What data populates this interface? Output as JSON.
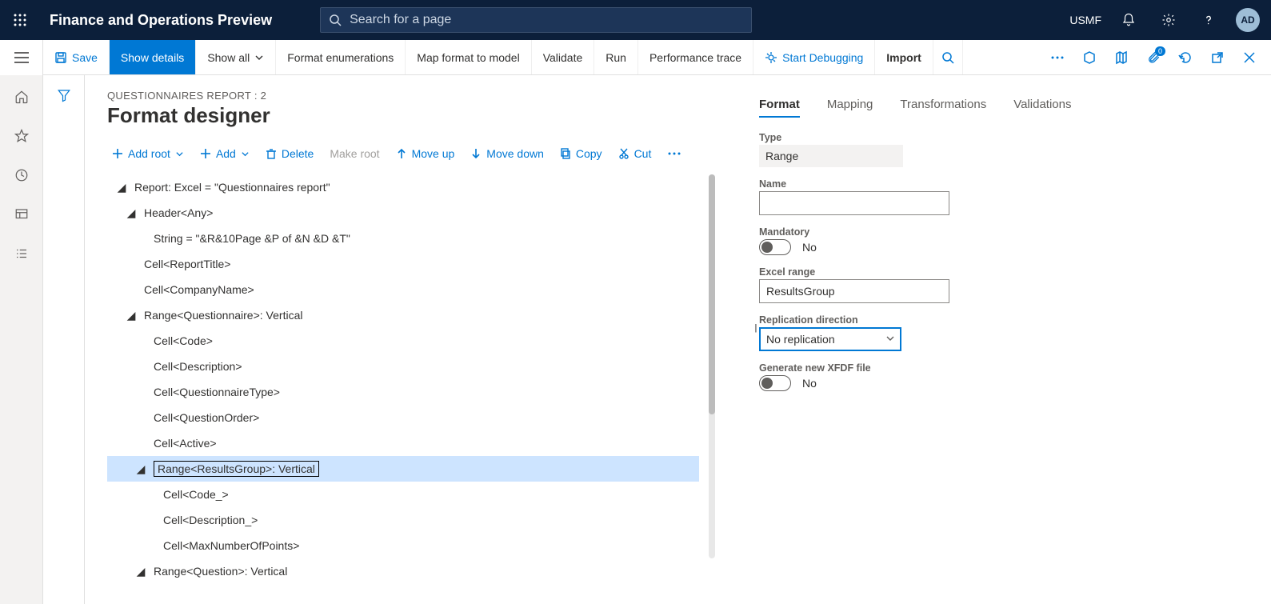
{
  "topbar": {
    "app_title": "Finance and Operations Preview",
    "search_placeholder": "Search for a page",
    "company": "USMF",
    "avatar_initials": "AD"
  },
  "cmdbar": {
    "save": "Save",
    "show_details": "Show details",
    "show_all": "Show all",
    "format_enum": "Format enumerations",
    "map_format": "Map format to model",
    "validate": "Validate",
    "run": "Run",
    "perf_trace": "Performance trace",
    "start_debugging": "Start Debugging",
    "import": "Import",
    "attach_badge": "0"
  },
  "header": {
    "breadcrumb": "QUESTIONNAIRES REPORT : 2",
    "page_title": "Format designer"
  },
  "tree_toolbar": {
    "add_root": "Add root",
    "add": "Add",
    "delete": "Delete",
    "make_root": "Make root",
    "move_up": "Move up",
    "move_down": "Move down",
    "copy": "Copy",
    "cut": "Cut"
  },
  "tree": {
    "n0": "Report: Excel = \"Questionnaires report\"",
    "n1": "Header<Any>",
    "n2": "String = \"&R&10Page &P of &N &D &T\"",
    "n3": "Cell<ReportTitle>",
    "n4": "Cell<CompanyName>",
    "n5": "Range<Questionnaire>: Vertical",
    "n6": "Cell<Code>",
    "n7": "Cell<Description>",
    "n8": "Cell<QuestionnaireType>",
    "n9": "Cell<QuestionOrder>",
    "n10": "Cell<Active>",
    "n11": "Range<ResultsGroup>: Vertical",
    "n12": "Cell<Code_>",
    "n13": "Cell<Description_>",
    "n14": "Cell<MaxNumberOfPoints>",
    "n15": "Range<Question>: Vertical"
  },
  "tabs": {
    "format": "Format",
    "mapping": "Mapping",
    "transformations": "Transformations",
    "validations": "Validations"
  },
  "form": {
    "type_label": "Type",
    "type_value": "Range",
    "name_label": "Name",
    "name_value": "",
    "mandatory_label": "Mandatory",
    "mandatory_value": "No",
    "excel_range_label": "Excel range",
    "excel_range_value": "ResultsGroup",
    "replication_label": "Replication direction",
    "replication_value": "No replication",
    "xfdf_label": "Generate new XFDF file",
    "xfdf_value": "No"
  }
}
